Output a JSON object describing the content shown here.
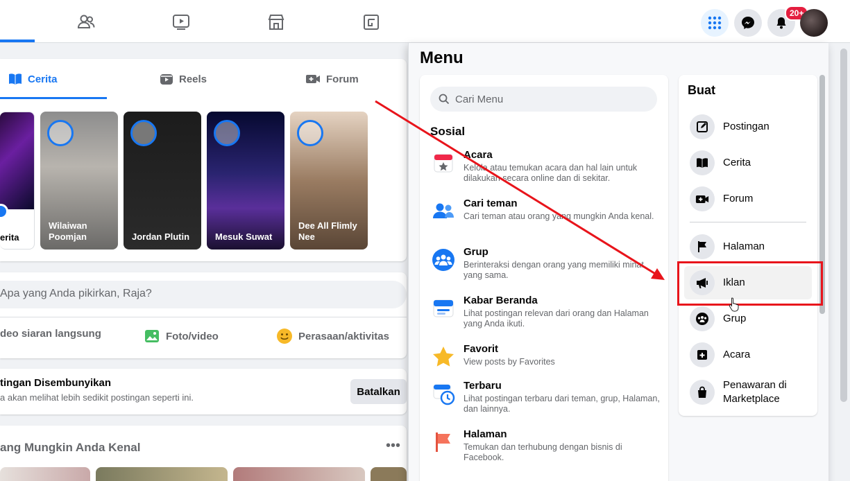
{
  "colors": {
    "brand": "#1877f2",
    "annotation": "#e8141b",
    "badge": "#e41e3f"
  },
  "topbar": {
    "badge_count": "20+",
    "icons": [
      "friends-icon",
      "watch-icon",
      "marketplace-icon",
      "gaming-icon",
      "grid-menu-icon",
      "messenger-icon",
      "notifications-icon"
    ]
  },
  "stories": {
    "tabs": [
      {
        "label": "Cerita",
        "icon": "book-icon",
        "active": true
      },
      {
        "label": "Reels",
        "icon": "reels-icon",
        "active": false
      },
      {
        "label": "Forum",
        "icon": "forum-icon",
        "active": false
      }
    ],
    "create_label": "erita",
    "items": [
      {
        "name": "Wilaiwan\nPoomjan",
        "line1": "Wilaiwan",
        "line2": "Poomjan"
      },
      {
        "name": "Jordan Plutin",
        "line1": "Jordan Plutin",
        "line2": ""
      },
      {
        "name": "Mesuk Suwat",
        "line1": "Mesuk Suwat",
        "line2": ""
      },
      {
        "name": "Dee All Flimly Nee",
        "line1": "Dee All Flimly",
        "line2": "Nee"
      }
    ]
  },
  "composer": {
    "placeholder": "Apa yang Anda pikirkan, Raja?",
    "actions": {
      "live": "deo siaran langsung",
      "photo": "Foto/video",
      "feeling": "Perasaan/aktivitas"
    }
  },
  "hidden_post": {
    "title": "tingan Disembunyikan",
    "subtitle": "a akan melihat lebih sedikit postingan seperti ini.",
    "undo_label": "Batalkan"
  },
  "pymk": {
    "title": "ang Mungkin Anda Kenal",
    "more": "•••"
  },
  "menu": {
    "title": "Menu",
    "search_placeholder": "Cari Menu",
    "social_title": "Sosial",
    "social_items": [
      {
        "title": "Acara",
        "desc": "Kelola atau temukan acara dan hal lain untuk dilakukan secara online dan di sekitar.",
        "icon": "calendar-icon"
      },
      {
        "title": "Cari teman",
        "desc": "Cari teman atau orang yang mungkin Anda kenal.",
        "icon": "find-friends-icon"
      },
      {
        "title": "Grup",
        "desc": "Berinteraksi dengan orang yang memiliki minat yang sama.",
        "icon": "groups-icon"
      },
      {
        "title": "Kabar Beranda",
        "desc": "Lihat postingan relevan dari orang dan Halaman yang Anda ikuti.",
        "icon": "feed-icon"
      },
      {
        "title": "Favorit",
        "desc": "View posts by Favorites",
        "icon": "star-icon"
      },
      {
        "title": "Terbaru",
        "desc": "Lihat postingan terbaru dari teman, grup, Halaman, dan lainnya.",
        "icon": "recent-icon"
      },
      {
        "title": "Halaman",
        "desc": "Temukan dan terhubung dengan bisnis di Facebook.",
        "icon": "flag-icon"
      }
    ],
    "create_title": "Buat",
    "create_items": [
      {
        "label": "Postingan",
        "icon": "compose-icon"
      },
      {
        "label": "Cerita",
        "icon": "book-icon"
      },
      {
        "label": "Forum",
        "icon": "forum-icon"
      },
      {
        "label": "Halaman",
        "icon": "flag-icon"
      },
      {
        "label": "Iklan",
        "icon": "megaphone-icon"
      },
      {
        "label": "Grup",
        "icon": "groups-icon"
      },
      {
        "label": "Acara",
        "icon": "event-plus-icon"
      },
      {
        "label": "Penawaran di Marketplace",
        "icon": "shopping-bag-icon"
      }
    ]
  }
}
